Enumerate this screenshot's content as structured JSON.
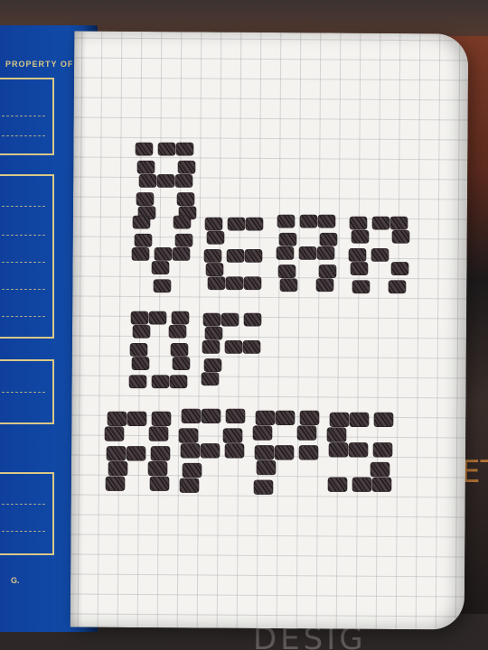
{
  "notebook_cover": {
    "heading": "PROPERTY OF:",
    "footer_mark": "G."
  },
  "page": {
    "handwritten_lines": [
      "A",
      "YEAR",
      "OF",
      "APPS"
    ]
  },
  "background": {
    "bottom_text": "DESIG",
    "side_text": "ETG"
  },
  "colors": {
    "cover_blue": "#114aa8",
    "cover_gold": "#d9c887",
    "paper": "#f4f3f0",
    "grid": "#9696a0",
    "ink": "#2b2326"
  }
}
